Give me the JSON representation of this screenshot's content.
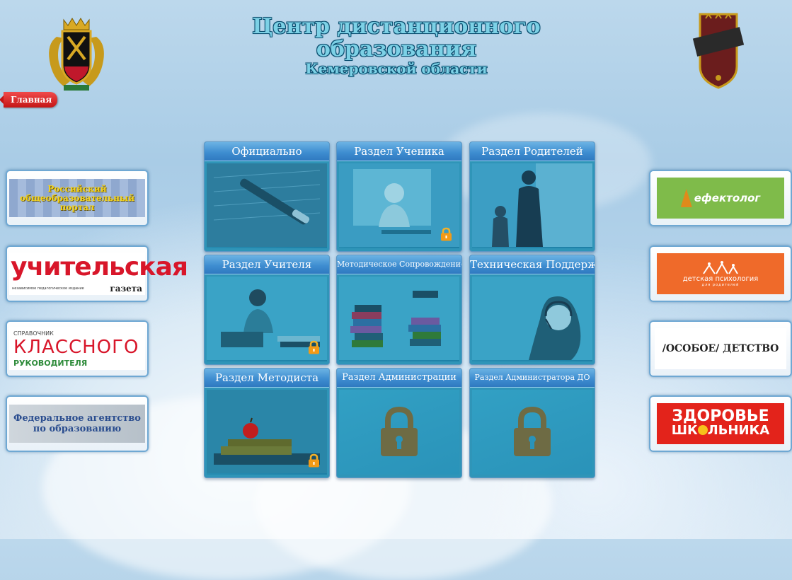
{
  "header": {
    "title_line1": "Центр дистанционного",
    "title_line2": "образования",
    "title_line3": "Кемеровской области"
  },
  "nav": {
    "home_label": "Главная"
  },
  "left_links": [
    {
      "name": "russian-education-portal",
      "text1": "Российский",
      "text2": "общеобразовательный",
      "text3": "портал"
    },
    {
      "name": "uchitelskaya-gazeta",
      "text1": "учительская",
      "text2": "независимое педагогическое издание",
      "text3": "газета"
    },
    {
      "name": "klassnogo-rukovoditelya",
      "text1": "СПРАВОЧНИК",
      "text2": "КЛАССНОГО",
      "text3": "РУКОВОДИТЕЛЯ"
    },
    {
      "name": "federal-agency-education",
      "text1": "Федеральное агентство",
      "text2": "по образованию"
    }
  ],
  "right_links": [
    {
      "name": "defektolog",
      "text": "ефектолог"
    },
    {
      "name": "detskaya-psikhologiya",
      "text1": "детская психология",
      "text2": "для родителей"
    },
    {
      "name": "osoboe-detstvo",
      "text": "/ОСОБОЕ/ ДЕТСТВО"
    },
    {
      "name": "zdorovye-shkolnika",
      "text1": "ЗДОРОВЬЕ",
      "text2": "ШК",
      "text3": "ЛЬНИКА"
    }
  ],
  "tiles": [
    {
      "title": "Официально"
    },
    {
      "title": "Раздел Ученика"
    },
    {
      "title": "Раздел Родителей"
    },
    {
      "title": "Раздел Учителя"
    },
    {
      "title": "Методическое Сопровождение"
    },
    {
      "title": "Техническая Поддержка"
    },
    {
      "title": "Раздел Методиста"
    },
    {
      "title": "Раздел Администрации"
    },
    {
      "title": "Раздел Администратора ДО"
    }
  ],
  "colors": {
    "accent": "#3f8ed1",
    "tile_bg": "#2f95b8",
    "home_tab": "#c41515",
    "title_text": "#7cd1e6"
  }
}
